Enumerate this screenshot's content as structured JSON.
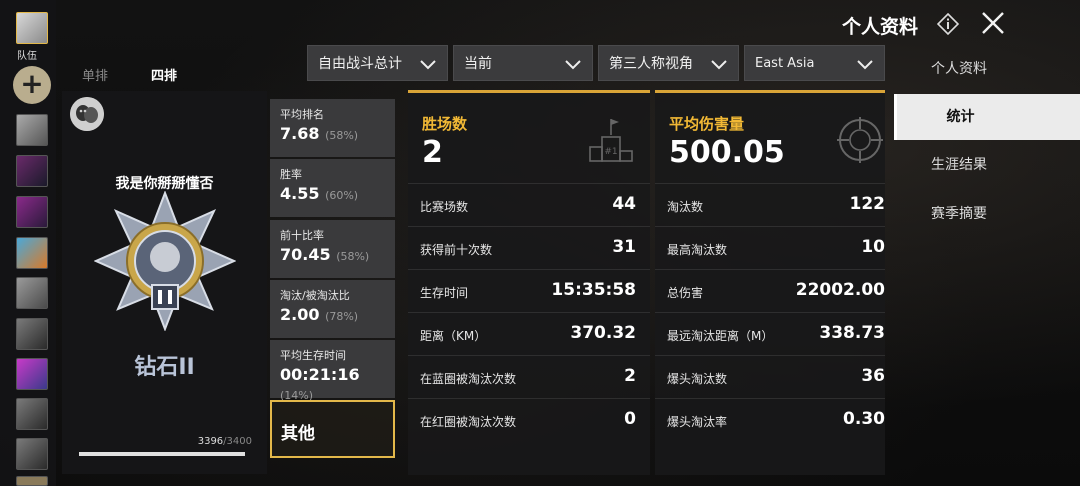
{
  "friends": {
    "team_label": "队伍",
    "add_label": "+"
  },
  "header": {
    "title": "个人资料"
  },
  "modes": {
    "solo": "单排",
    "squad": "四排"
  },
  "filters": {
    "mode": "自由战斗总计",
    "season": "当前",
    "perspective": "第三人称视角",
    "region": "East Asia"
  },
  "nav": {
    "profile": "个人资料",
    "stats": "统计",
    "career": "生涯结果",
    "season_summary": "赛季摘要"
  },
  "profile": {
    "player_name": "我是你掰掰懂否",
    "rank_name": "钻石II",
    "rank_points": "3396",
    "rank_points_max": "/3400",
    "rank_progress": 0.9988
  },
  "stat_boxes": [
    {
      "label": "平均排名",
      "value": "7.68",
      "pct": "(58%)"
    },
    {
      "label": "胜率",
      "value": "4.55",
      "pct": "(60%)"
    },
    {
      "label": "前十比率",
      "value": "70.45",
      "pct": "(58%)"
    },
    {
      "label": "淘汰/被淘汰比",
      "value": "2.00",
      "pct": "(78%)"
    },
    {
      "label": "平均生存时间",
      "value": "00:21:16",
      "pct": "(14%)"
    }
  ],
  "other_label": "其他",
  "wins_panel": {
    "label": "胜场数",
    "value": "2",
    "icon": "podium-icon",
    "rows": [
      {
        "k": "比赛场数",
        "v": "44"
      },
      {
        "k": "获得前十次数",
        "v": "31"
      },
      {
        "k": "生存时间",
        "v": "15:35:58"
      },
      {
        "k": "距离（KM）",
        "v": "370.32"
      },
      {
        "k": "在蓝圈被淘汰次数",
        "v": "2"
      },
      {
        "k": "在红圈被淘汰次数",
        "v": "0"
      }
    ]
  },
  "damage_panel": {
    "label": "平均伤害量",
    "value": "500.05",
    "icon": "crosshair-icon",
    "rows": [
      {
        "k": "淘汰数",
        "v": "122"
      },
      {
        "k": "最高淘汰数",
        "v": "10"
      },
      {
        "k": "总伤害",
        "v": "22002.00"
      },
      {
        "k": "最远淘汰距离（M）",
        "v": "338.73"
      },
      {
        "k": "爆头淘汰数",
        "v": "36"
      },
      {
        "k": "爆头淘汰率",
        "v": "0.30"
      }
    ]
  },
  "colors": {
    "accent": "#f2b935",
    "rank": "#b9c4d8"
  }
}
